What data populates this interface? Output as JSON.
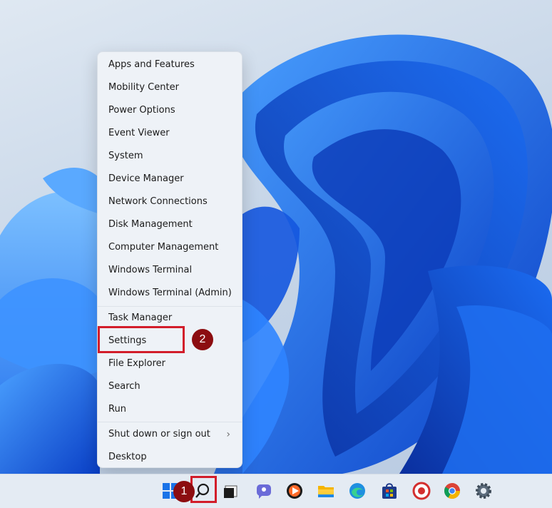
{
  "context_menu": {
    "items": [
      {
        "label": "Apps and Features"
      },
      {
        "label": "Mobility Center"
      },
      {
        "label": "Power Options"
      },
      {
        "label": "Event Viewer"
      },
      {
        "label": "System"
      },
      {
        "label": "Device Manager"
      },
      {
        "label": "Network Connections"
      },
      {
        "label": "Disk Management"
      },
      {
        "label": "Computer Management"
      },
      {
        "label": "Windows Terminal"
      },
      {
        "label": "Windows Terminal (Admin)"
      },
      {
        "label": "Task Manager"
      },
      {
        "label": "Settings"
      },
      {
        "label": "File Explorer"
      },
      {
        "label": "Search"
      },
      {
        "label": "Run"
      },
      {
        "label": "Shut down or sign out"
      },
      {
        "label": "Desktop"
      }
    ]
  },
  "annotations": {
    "step1": "1",
    "step2": "2",
    "highlight_color": "#d21d2a",
    "badge_color": "#8c0d10"
  },
  "taskbar": {
    "icons": [
      "start-icon",
      "search-icon",
      "task-view-icon",
      "chat-icon",
      "media-player-icon",
      "file-explorer-icon",
      "edge-icon",
      "store-icon",
      "app-icon",
      "chrome-icon",
      "settings-icon"
    ]
  }
}
